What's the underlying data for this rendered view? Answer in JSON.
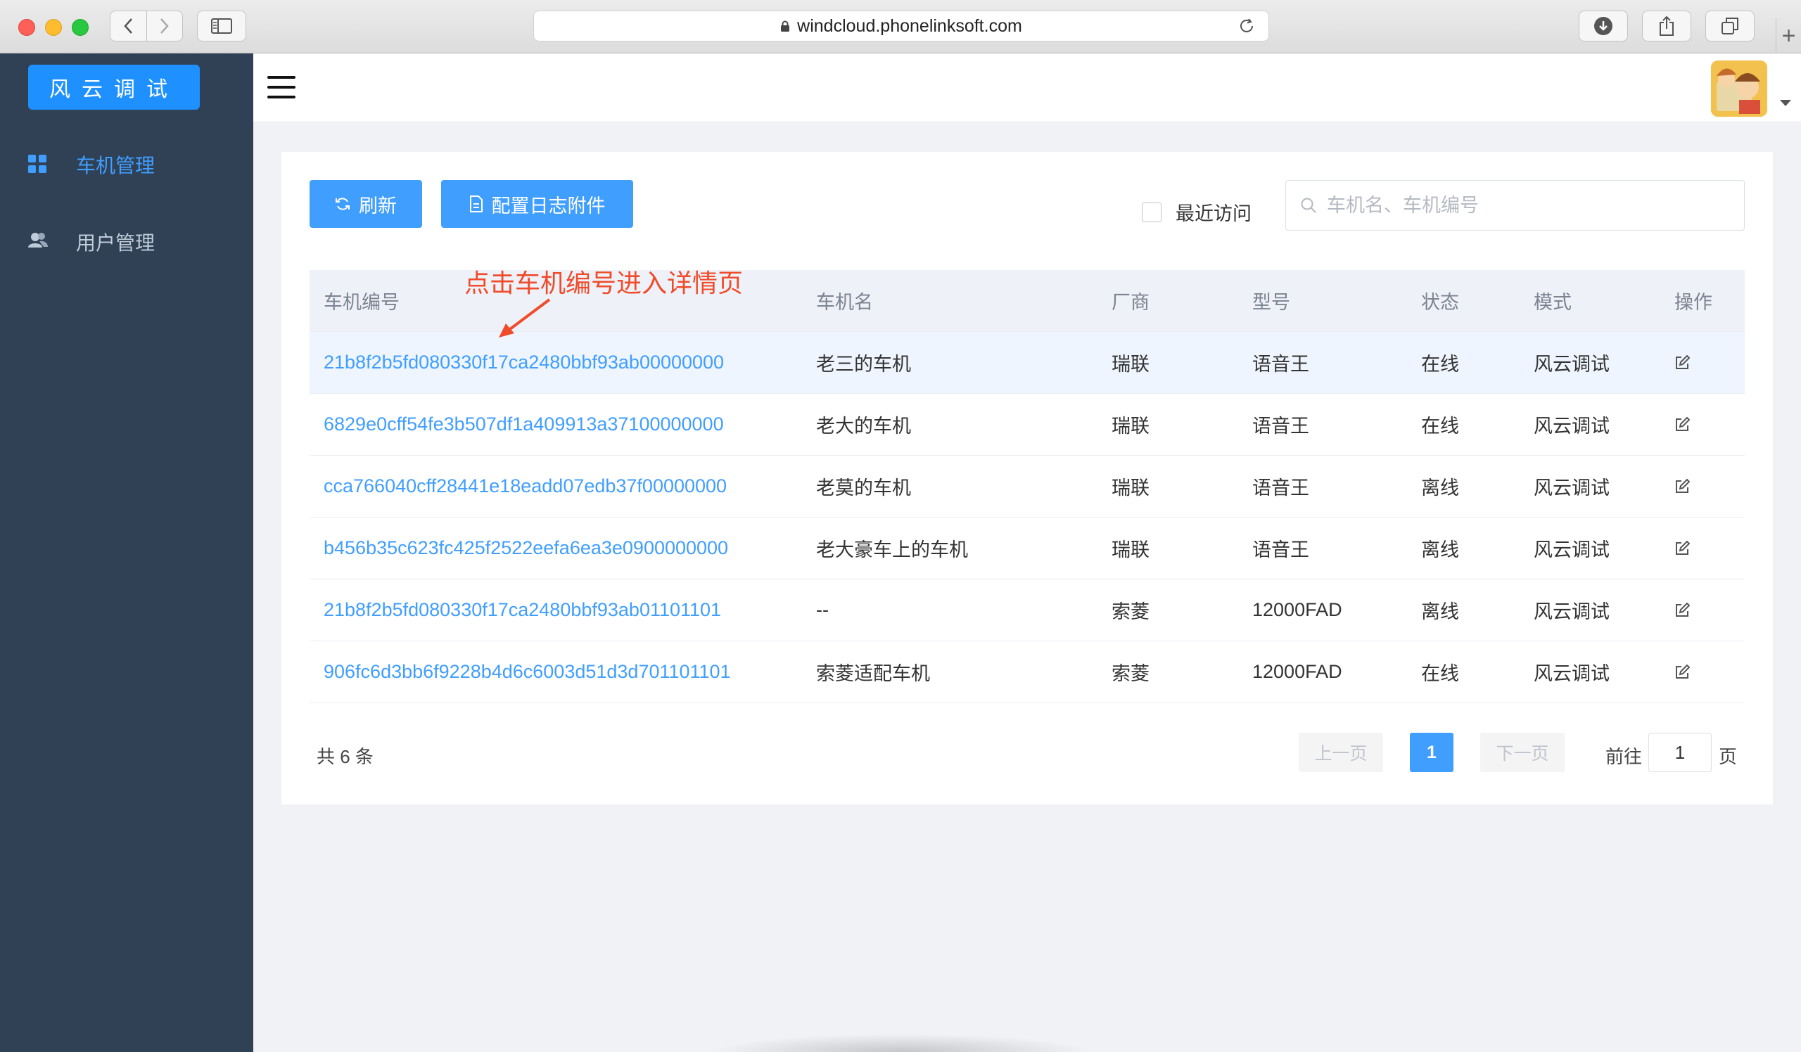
{
  "browser": {
    "url": "windcloud.phonelinksoft.com"
  },
  "sidebar": {
    "logo": "风云调试",
    "items": [
      {
        "label": "车机管理",
        "icon": "grid-icon",
        "active": true
      },
      {
        "label": "用户管理",
        "icon": "users-icon",
        "active": false
      }
    ]
  },
  "toolbar": {
    "refresh_label": "刷新",
    "config_label": "配置日志附件",
    "recent_label": "最近访问",
    "search_placeholder": "车机名、车机编号"
  },
  "annotation": "点击车机编号进入详情页",
  "table": {
    "headers": [
      "车机编号",
      "车机名",
      "厂商",
      "型号",
      "状态",
      "模式",
      "操作"
    ],
    "rows": [
      {
        "id": "21b8f2b5fd080330f17ca2480bbf93ab00000000",
        "name": "老三的车机",
        "vendor": "瑞联",
        "model": "语音王",
        "status": "在线",
        "mode": "风云调试"
      },
      {
        "id": "6829e0cff54fe3b507df1a409913a37100000000",
        "name": "老大的车机",
        "vendor": "瑞联",
        "model": "语音王",
        "status": "在线",
        "mode": "风云调试"
      },
      {
        "id": "cca766040cff28441e18eadd07edb37f00000000",
        "name": "老莫的车机",
        "vendor": "瑞联",
        "model": "语音王",
        "status": "离线",
        "mode": "风云调试"
      },
      {
        "id": "b456b35c623fc425f2522eefa6ea3e0900000000",
        "name": "老大豪车上的车机",
        "vendor": "瑞联",
        "model": "语音王",
        "status": "离线",
        "mode": "风云调试"
      },
      {
        "id": "21b8f2b5fd080330f17ca2480bbf93ab01101101",
        "name": "--",
        "vendor": "索菱",
        "model": "12000FAD",
        "status": "离线",
        "mode": "风云调试"
      },
      {
        "id": "906fc6d3bb6f9228b4d6c6003d51d3d701101101",
        "name": "索菱适配车机",
        "vendor": "索菱",
        "model": "12000FAD",
        "status": "在线",
        "mode": "风云调试"
      }
    ]
  },
  "pagination": {
    "total_label": "共 6 条",
    "prev_label": "上一页",
    "current_page": "1",
    "next_label": "下一页",
    "goto_prefix": "前往",
    "goto_value": "1",
    "goto_suffix": "页"
  },
  "colors": {
    "primary": "#409eff",
    "sidebar_bg": "#304156",
    "annotation": "#f04b2a"
  }
}
